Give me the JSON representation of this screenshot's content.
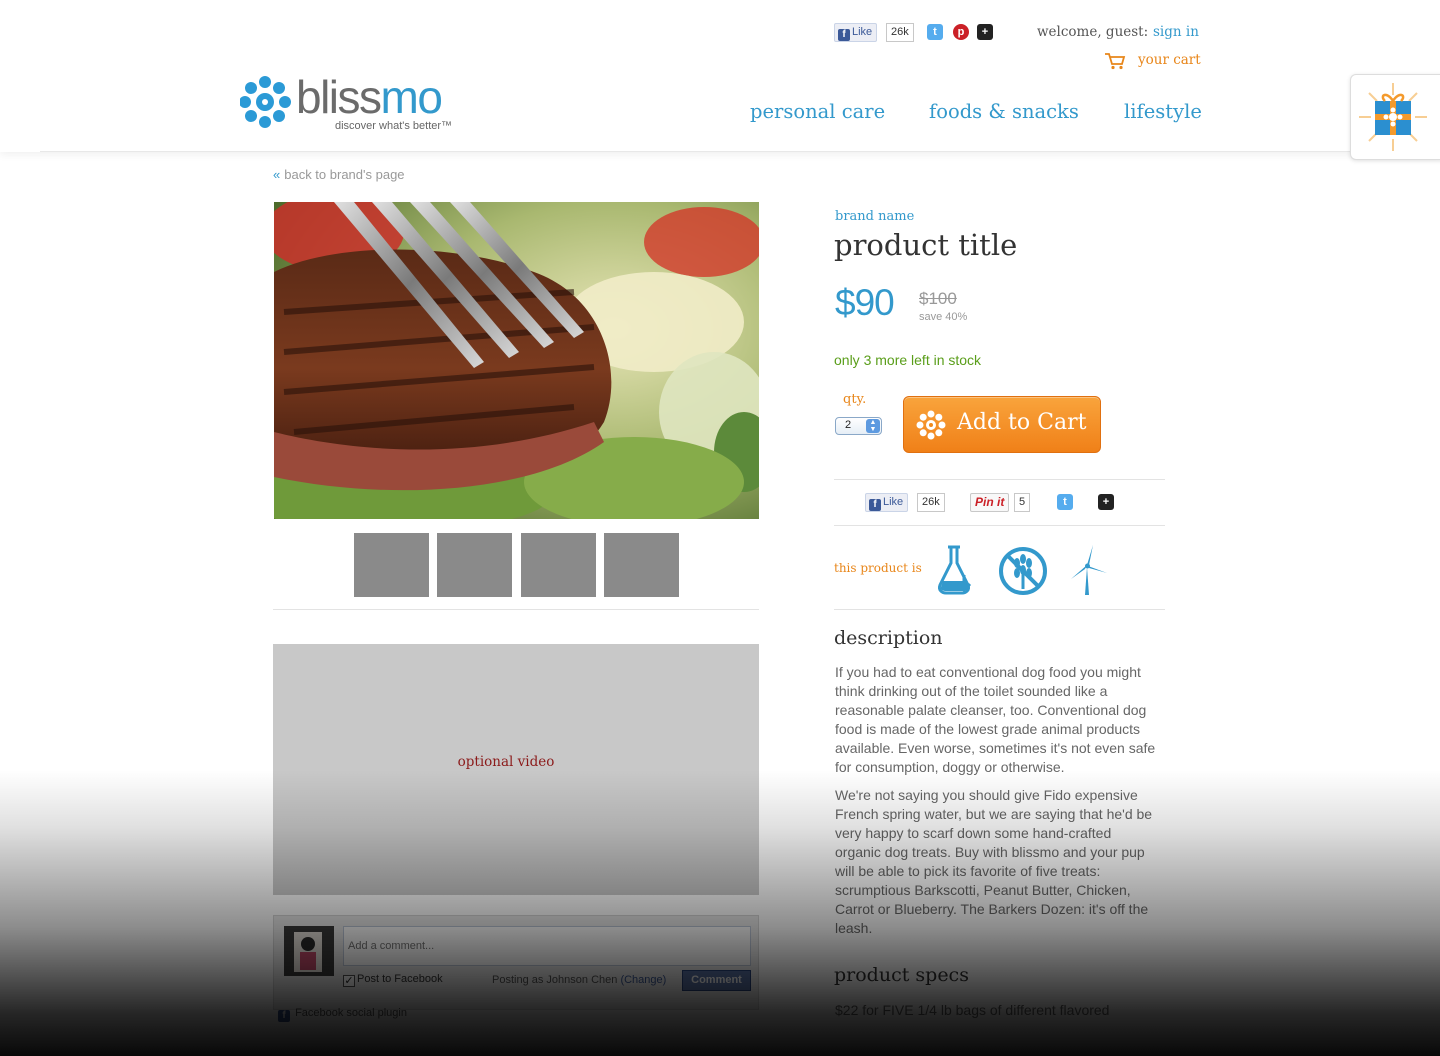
{
  "header": {
    "logo_word_bliss": "bliss",
    "logo_word_mo": "mo",
    "logo_tagline": "discover what's better™",
    "social": {
      "like_label": "Like",
      "like_count": "26k"
    },
    "welcome_text": "welcome, guest:",
    "sign_in": "sign in",
    "cart_label": "your cart",
    "nav": [
      "personal care",
      "foods & snacks",
      "lifestyle"
    ]
  },
  "back_link": "back to brand's page",
  "media": {
    "video_label": "optional video"
  },
  "comments": {
    "placeholder": "Add a comment...",
    "post_to_facebook": "Post to Facebook",
    "posting_as": "Posting as Johnson Chen",
    "change_label": "(Change)",
    "comment_button": "Comment",
    "plugin_label": "Facebook social plugin"
  },
  "product": {
    "brand_name": "brand name",
    "title": "product title",
    "price": "$90",
    "original_price": "$100",
    "savings": "save 40%",
    "stock_message": "only 3 more left in stock",
    "qty_label": "qty.",
    "qty_value": "2",
    "add_to_cart": "Add to Cart",
    "social": {
      "like_label": "Like",
      "like_count": "26k",
      "pin_label": "Pin it",
      "pin_count": "5"
    },
    "attributes_label": "this product is",
    "attribute_icons": [
      "chemical-free-icon",
      "gluten-free-icon",
      "wind-energy-icon"
    ],
    "description_heading": "description",
    "description": [
      "If you had to eat conventional dog food you might think drinking out of the toilet sounded like a reasonable palate cleanser, too. Conventional dog food is made of the lowest grade animal products available. Even worse, sometimes it's not even safe for consumption, doggy or otherwise.",
      "We're not saying you should give Fido expensive French spring water, but we are saying that he'd be very happy to scarf down some hand-crafted organic dog treats. Buy with blissmo and your pup will be able to pick its favorite of five treats: scrumptious Barkscotti, Peanut Butter, Chicken, Carrot or Blueberry. The Barkers Dozen: it's off the leash."
    ],
    "specs_heading": "product specs",
    "specs_text": "$22 for FIVE 1/4 lb bags of different flavored"
  },
  "colors": {
    "brand_blue": "#3399cc",
    "accent_orange": "#f08a1c",
    "stock_green": "#5a9e1a"
  }
}
